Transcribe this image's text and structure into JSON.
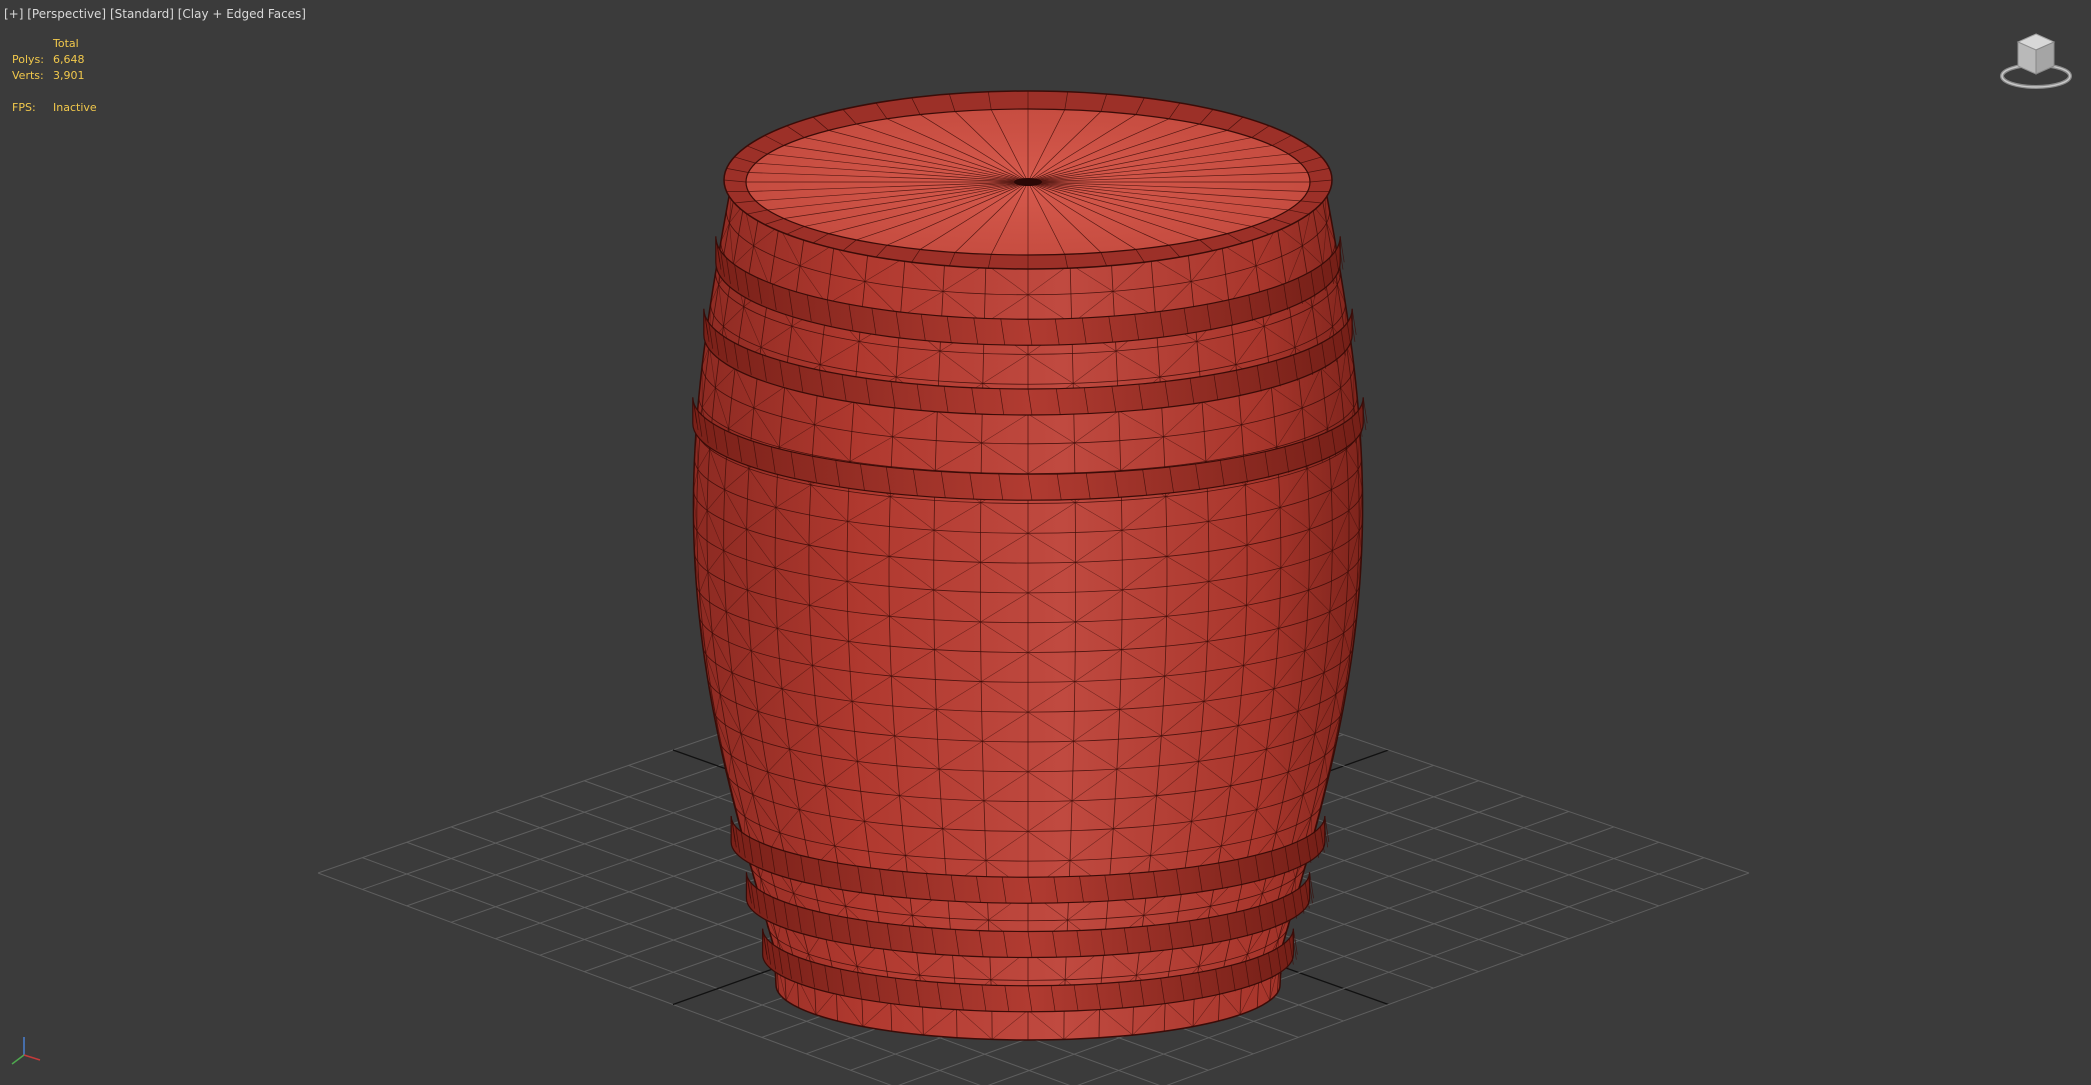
{
  "viewport": {
    "labels": [
      "[+]",
      "[Perspective]",
      "[Standard]",
      "[Clay + Edged Faces]"
    ],
    "stats": {
      "header": "Total",
      "rows": [
        {
          "key": "Polys:",
          "value": "6,648"
        },
        {
          "key": "Verts:",
          "value": "3,901"
        }
      ],
      "fps_key": "FPS:",
      "fps_value": "Inactive"
    }
  },
  "colors": {
    "background": "#3b3b3b",
    "grid": "#5e5e5e",
    "grid_axis": "#111111",
    "clay": "#b8443a",
    "wire": "#3a0c08",
    "stats_text": "#f2c94c",
    "label_text": "#d9d9d9"
  },
  "icons": {
    "viewcube": "viewcube-icon",
    "axis_tripod": "axis-tripod-icon"
  }
}
